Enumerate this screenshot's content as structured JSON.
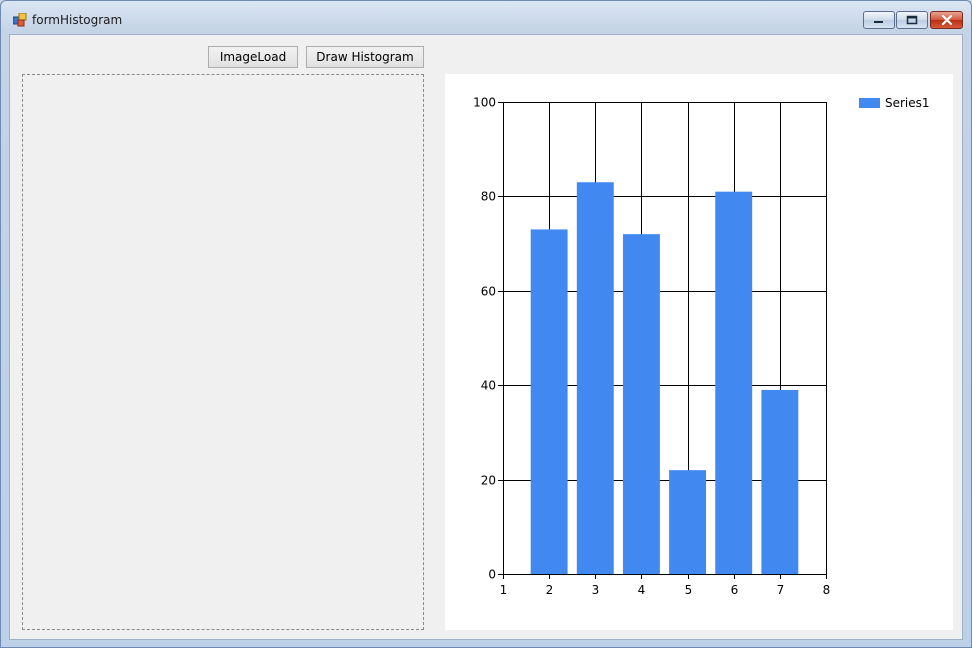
{
  "window": {
    "title": "formHistogram",
    "app_icon": "winforms-app-icon",
    "caption_buttons": [
      "minimize-icon",
      "maximize-icon",
      "close-icon"
    ]
  },
  "toolbar": {
    "image_load_label": "ImageLoad",
    "draw_histogram_label": "Draw Histogram"
  },
  "chart_data": {
    "type": "bar",
    "x": [
      2,
      3,
      4,
      5,
      6,
      7
    ],
    "series": [
      {
        "name": "Series1",
        "values": [
          73,
          83,
          72,
          22,
          81,
          39
        ],
        "color": "#4189f0"
      }
    ],
    "xlim": [
      1,
      8
    ],
    "ylim": [
      0,
      100
    ],
    "x_ticks": [
      1,
      2,
      3,
      4,
      5,
      6,
      7,
      8
    ],
    "y_ticks": [
      0,
      20,
      40,
      60,
      80,
      100
    ],
    "grid": true,
    "legend_position": "top-right"
  }
}
